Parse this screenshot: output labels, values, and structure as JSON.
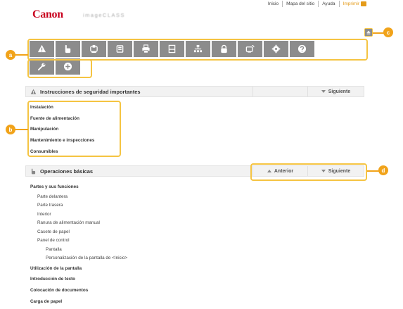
{
  "toplinks": {
    "inicio": "Inicio",
    "mapa": "Mapa del sitio",
    "ayuda": "Ayuda",
    "imprimir": "Imprimir"
  },
  "header": {
    "logo": "Canon",
    "product": "imageCLASS"
  },
  "toolbar": {
    "row1_icons": [
      "warning-icon",
      "hand-icon",
      "copy-icon",
      "fax-icon",
      "print-icon",
      "scan-icon",
      "network-icon",
      "lock-icon",
      "remote-icon",
      "gear-icon",
      "help-icon"
    ],
    "row2_icons": [
      "wrench-icon",
      "plus-icon"
    ]
  },
  "callouts": {
    "a": "a",
    "b": "b",
    "c": "c",
    "d": "d"
  },
  "section1": {
    "title": "Instrucciones de seguridad importantes",
    "next": "Siguiente",
    "items": [
      "Instalación",
      "Fuente de alimentación",
      "Manipulación",
      "Mantenimiento e inspecciones",
      "Consumibles"
    ]
  },
  "section2": {
    "title": "Operaciones básicas",
    "prev": "Anterior",
    "next": "Siguiente",
    "group_title": "Partes y sus funciones",
    "sub_items": [
      "Parte delantera",
      "Parte trasera",
      "Interior",
      "Ranura de alimentación manual",
      "Casete de papel",
      "Panel de control"
    ],
    "sub_sub_items": [
      "Pantalla",
      "Personalización de la pantalla de <Inicio>"
    ],
    "items": [
      "Utilización de la pantalla",
      "Introducción de texto",
      "Colocación de documentos",
      "Carga de papel"
    ]
  },
  "colors": {
    "accent": "#f1a31a",
    "highlight": "#f5c442",
    "toolbar": "#8c8c8c",
    "brand": "#c8001e"
  }
}
